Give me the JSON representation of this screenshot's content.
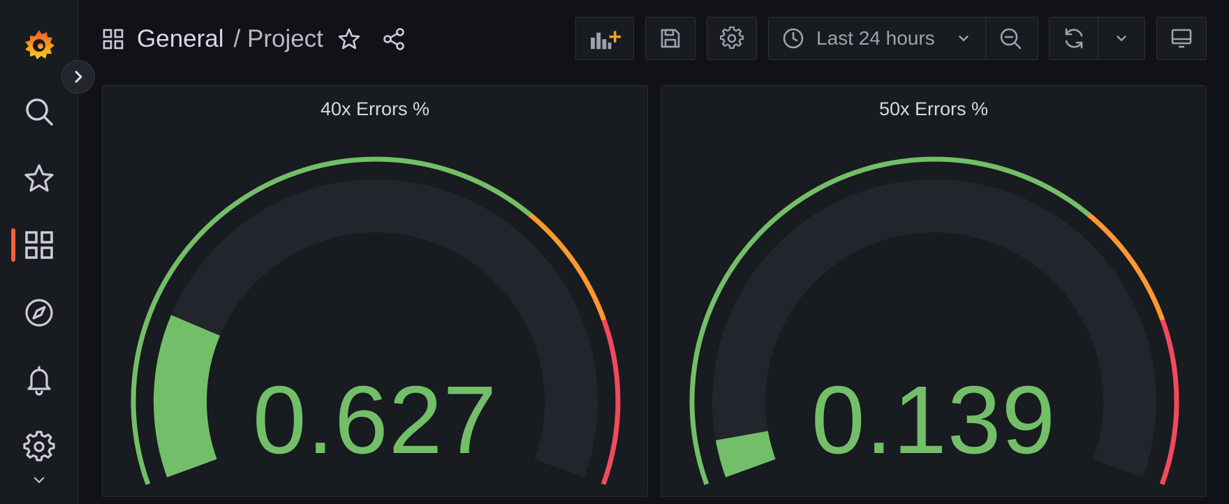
{
  "breadcrumb": {
    "folder": "General",
    "dashboard": "/ Project"
  },
  "toolbar": {
    "time_range": "Last 24 hours"
  },
  "colors": {
    "green": "#73bf69",
    "orange": "#ff9830",
    "red": "#f2495c",
    "track": "#22252b",
    "accent": "#f55f3e"
  },
  "sidebar": {
    "items": [
      {
        "icon": "search-icon"
      },
      {
        "icon": "star-icon"
      },
      {
        "icon": "dashboards-icon",
        "active": true
      },
      {
        "icon": "compass-icon"
      },
      {
        "icon": "bell-icon"
      },
      {
        "icon": "gear-icon"
      }
    ]
  },
  "panels": [
    {
      "title": "40x Errors %",
      "value": "0.627",
      "fraction": 0.195
    },
    {
      "title": "50x Errors %",
      "value": "0.139",
      "fraction": 0.045
    }
  ],
  "thresholds": [
    {
      "color": "green",
      "to": 0.68
    },
    {
      "color": "orange",
      "to": 0.82
    },
    {
      "color": "red",
      "to": 1.0
    }
  ]
}
